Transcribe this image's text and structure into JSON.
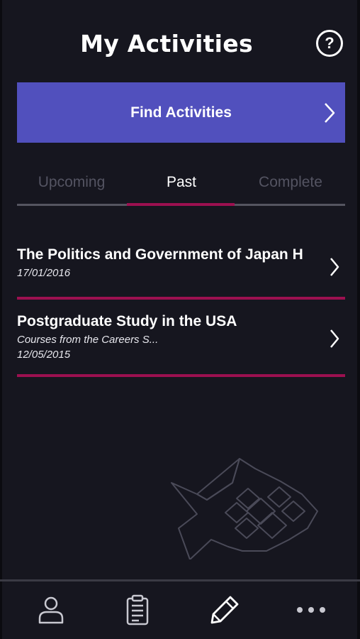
{
  "header": {
    "title": "My Activities",
    "help_icon": "question-circle-icon",
    "help_label": "?"
  },
  "find_button": {
    "label": "Find Activities",
    "color": "#5150bd",
    "icon": "chevron-right-icon"
  },
  "tabs": [
    {
      "label": "Upcoming",
      "active": false
    },
    {
      "label": "Past",
      "active": true
    },
    {
      "label": "Complete",
      "active": false
    }
  ],
  "activities": [
    {
      "title": "The Politics and Government of Japan H",
      "date": "17/01/2016"
    },
    {
      "title": "Postgraduate Study in the USA",
      "subtitle": "Courses from the Careers S...",
      "date": "12/05/2015"
    }
  ],
  "colors": {
    "background": "#16161f",
    "accent": "#9c1050",
    "inactive_tab": "#545462"
  },
  "bottom_nav": [
    {
      "icon": "person-icon"
    },
    {
      "icon": "clipboard-icon"
    },
    {
      "icon": "pencil-icon"
    },
    {
      "icon": "more-dots-icon"
    }
  ]
}
